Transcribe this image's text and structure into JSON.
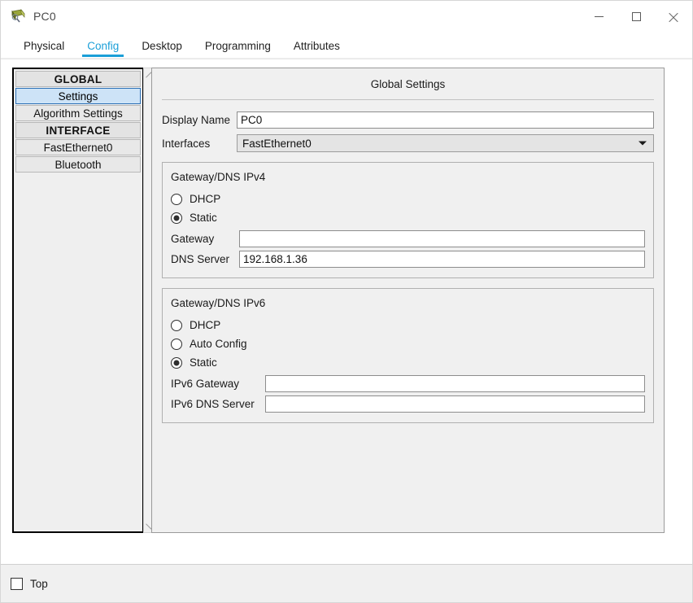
{
  "window": {
    "title": "PC0",
    "icon": "pc-device-icon",
    "controls": {
      "minimize": "minimize-icon",
      "maximize": "maximize-icon",
      "close": "close-icon"
    }
  },
  "tabs": [
    {
      "label": "Physical",
      "active": false
    },
    {
      "label": "Config",
      "active": true
    },
    {
      "label": "Desktop",
      "active": false
    },
    {
      "label": "Programming",
      "active": false
    },
    {
      "label": "Attributes",
      "active": false
    }
  ],
  "sidebar": {
    "items": [
      {
        "label": "GLOBAL",
        "type": "header",
        "selected": false
      },
      {
        "label": "Settings",
        "type": "item",
        "selected": true
      },
      {
        "label": "Algorithm Settings",
        "type": "item",
        "selected": false
      },
      {
        "label": "INTERFACE",
        "type": "header",
        "selected": false
      },
      {
        "label": "FastEthernet0",
        "type": "item",
        "selected": false
      },
      {
        "label": "Bluetooth",
        "type": "item",
        "selected": false
      }
    ],
    "scrollbar": {
      "up": "chevron-up-icon",
      "down": "chevron-down-icon"
    }
  },
  "settings": {
    "title": "Global Settings",
    "display_name": {
      "label": "Display Name",
      "value": "PC0",
      "placeholder": ""
    },
    "interfaces": {
      "label": "Interfaces",
      "value": "FastEthernet0",
      "arrow": "chevron-down-icon"
    },
    "ipv4": {
      "title": "Gateway/DNS IPv4",
      "options": [
        {
          "label": "DHCP",
          "selected": false
        },
        {
          "label": "Static",
          "selected": true
        }
      ],
      "gateway": {
        "label": "Gateway",
        "value": "",
        "placeholder": ""
      },
      "dns": {
        "label": "DNS Server",
        "value": "192.168.1.36",
        "placeholder": ""
      }
    },
    "ipv6": {
      "title": "Gateway/DNS IPv6",
      "options": [
        {
          "label": "DHCP",
          "selected": false
        },
        {
          "label": "Auto Config",
          "selected": false
        },
        {
          "label": "Static",
          "selected": true
        }
      ],
      "gateway": {
        "label": "IPv6 Gateway",
        "value": "",
        "placeholder": ""
      },
      "dns": {
        "label": "IPv6 DNS Server",
        "value": "",
        "placeholder": ""
      }
    }
  },
  "statusbar": {
    "top_checkbox": {
      "label": "Top",
      "checked": false
    }
  },
  "colors": {
    "accent": "#1b9fd8",
    "selection_bg": "#cde3f7",
    "selection_border": "#2b6fb5",
    "panel_bg": "#f0f0f0",
    "window_bg": "#ffffff"
  }
}
